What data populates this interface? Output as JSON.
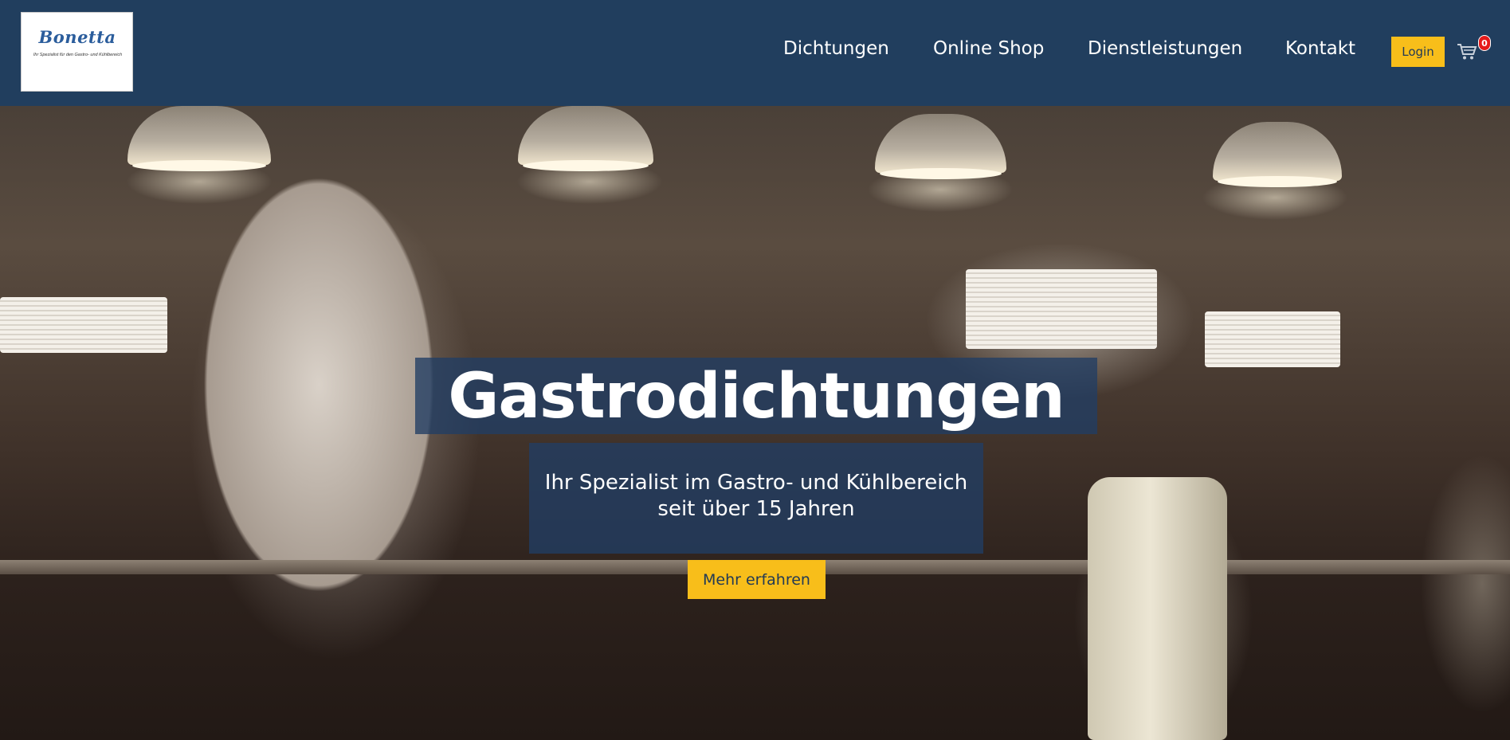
{
  "header": {
    "logo": {
      "wordmark": "Bonetta",
      "tagline": "Ihr Spezialist für den Gastro- und Kühlbereich"
    },
    "nav": [
      {
        "label": "Dichtungen"
      },
      {
        "label": "Online Shop"
      },
      {
        "label": "Dienstleistungen"
      },
      {
        "label": "Kontakt"
      }
    ],
    "login_label": "Login",
    "cart": {
      "icon": "shopping-cart-icon",
      "badge": "0"
    }
  },
  "hero": {
    "title": "Gastrodichtungen",
    "subtitle_line1": "Ihr Spezialist im Gastro- und Kühlbereich",
    "subtitle_line2": "seit über 15 Jahren",
    "cta_label": "Mehr erfahren",
    "background": "professional-kitchen-photo"
  },
  "colors": {
    "header_bg": "#213e5e",
    "accent_yellow": "#f8be1a",
    "badge_red": "#e51b1b",
    "overlay_blue": "#213e64"
  }
}
